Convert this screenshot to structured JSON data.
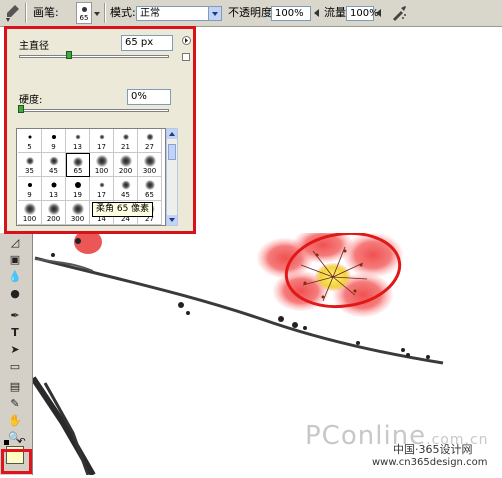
{
  "options_bar": {
    "brush_label": "画笔:",
    "brush_size": "65",
    "mode_label": "模式:",
    "mode_value": "正常",
    "opacity_label": "不透明度:",
    "opacity_value": "100%",
    "flow_label": "流量:",
    "flow_value": "100%"
  },
  "brush_popup": {
    "diameter_label": "主直径",
    "diameter_value": "65 px",
    "hardness_label": "硬度:",
    "hardness_value": "0%",
    "diameter_fraction": 0.33,
    "hardness_fraction": 0.0,
    "tooltip": "柔角 65 像素",
    "presets": [
      "5",
      "9",
      "13",
      "17",
      "21",
      "27",
      "35",
      "45",
      "65",
      "100",
      "200",
      "300",
      "9",
      "13",
      "19",
      "17",
      "45",
      "65",
      "100",
      "200",
      "300",
      "14",
      "24",
      "27"
    ]
  },
  "watermark": {
    "brand": "PConline",
    "domain_suffix": ".com.cn",
    "cn_site": "中国·365设计网",
    "url": "www.cn365design.com"
  },
  "colors": {
    "highlight_border": "#d8121b",
    "petal": "#f04040",
    "flower_center": "#f6e04a",
    "foreground_swatch": "#ffffc4"
  }
}
